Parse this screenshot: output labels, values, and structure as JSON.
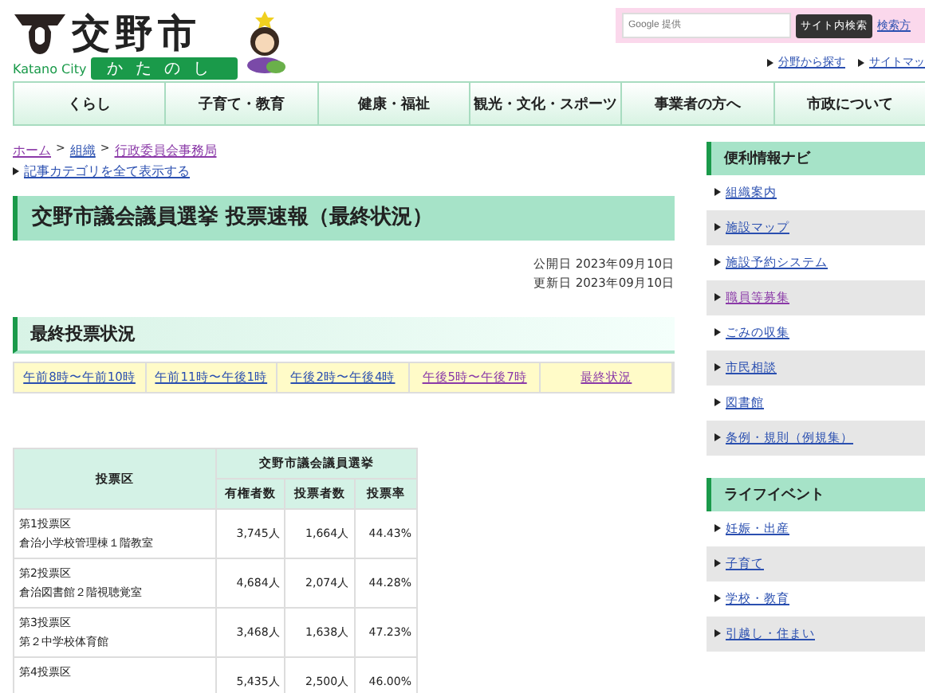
{
  "header": {
    "city_name": "交野市",
    "city_name_en": "Katano City",
    "city_kana": "かたのし",
    "search": {
      "placeholder": "Google 提供",
      "button": "サイト内検索",
      "help_link": "検索方"
    },
    "links": [
      "分野から探す",
      "サイトマッ"
    ]
  },
  "nav": [
    "くらし",
    "子育て・教育",
    "健康・福祉",
    "観光・文化・スポーツ",
    "事業者の方へ",
    "市政について"
  ],
  "breadcrumb": [
    {
      "label": "ホーム",
      "visited": true
    },
    {
      "separator": ">",
      "label": "組織",
      "visited": false
    },
    {
      "separator": ">",
      "label": "行政委員会事務局",
      "visited": true
    }
  ],
  "category_link": "記事カテゴリを全て表示する",
  "title": "交野市議会議員選挙 投票速報（最終状況）",
  "dates": [
    "公開日 2023年09月10日",
    "更新日 2023年09月10日"
  ],
  "section_heading": "最終投票状況",
  "time_tabs": [
    {
      "label": "午前8時〜午前10時",
      "visited": false
    },
    {
      "label": "午前11時〜午後1時",
      "visited": false
    },
    {
      "label": "午後2時〜午後4時",
      "visited": false
    },
    {
      "label": "午後5時〜午後7時",
      "visited": true
    },
    {
      "label": "最終状況",
      "visited": true
    }
  ],
  "table": {
    "group_header": "交野市議会議員選挙",
    "row_header": "投票区",
    "columns": [
      "有権者数",
      "投票者数",
      "投票率"
    ],
    "rows": [
      {
        "district": "第1投票区",
        "place": "倉治小学校管理棟１階教室",
        "cells": [
          "3,745人",
          "1,664人",
          "44.43%"
        ]
      },
      {
        "district": "第2投票区",
        "place": "倉治図書館２階視聴覚室",
        "cells": [
          "4,684人",
          "2,074人",
          "44.28%"
        ]
      },
      {
        "district": "第3投票区",
        "place": "第２中学校体育館",
        "cells": [
          "3,468人",
          "1,638人",
          "47.23%"
        ]
      },
      {
        "district": "第4投票区",
        "place": "",
        "cells": [
          "5,435人",
          "2,500人",
          "46.00%"
        ]
      }
    ]
  },
  "sidebar": [
    {
      "heading": "便利情報ナビ",
      "items": [
        {
          "label": "組織案内",
          "visited": false
        },
        {
          "label": "施設マップ",
          "visited": false
        },
        {
          "label": "施設予約システム",
          "visited": false
        },
        {
          "label": "職員等募集",
          "visited": true
        },
        {
          "label": "ごみの収集",
          "visited": false
        },
        {
          "label": "市民相談",
          "visited": false
        },
        {
          "label": "図書館",
          "visited": false
        },
        {
          "label": "条例・規則（例規集）",
          "visited": false
        }
      ]
    },
    {
      "heading": "ライフイベント",
      "items": [
        {
          "label": "妊娠・出産",
          "visited": false
        },
        {
          "label": "子育て",
          "visited": false
        },
        {
          "label": "学校・教育",
          "visited": false
        },
        {
          "label": "引越し・住まい",
          "visited": false
        }
      ]
    }
  ]
}
